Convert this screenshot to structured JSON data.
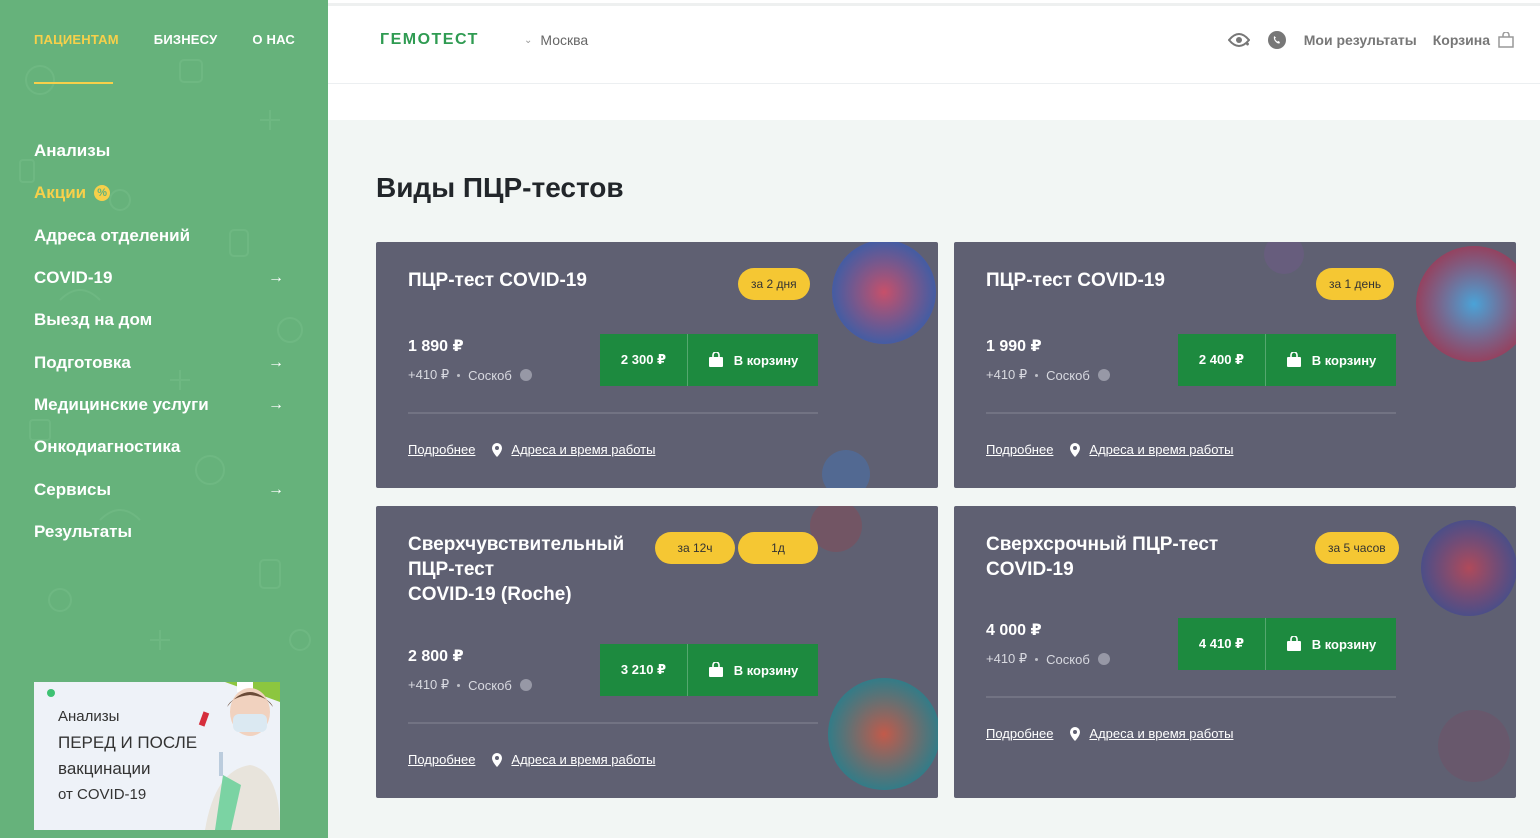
{
  "sidebar": {
    "topnav": [
      {
        "label": "ПАЦИЕНТАМ",
        "active": true
      },
      {
        "label": "БИЗНЕСУ",
        "active": false
      },
      {
        "label": "О НАС",
        "active": false
      }
    ],
    "menu": [
      {
        "label": "Анализы",
        "arrow": false
      },
      {
        "label": "Акции",
        "badge": "%",
        "promo": true,
        "arrow": false
      },
      {
        "label": "Адреса отделений",
        "arrow": false
      },
      {
        "label": "COVID-19",
        "arrow": true
      },
      {
        "label": "Выезд на дом",
        "arrow": false
      },
      {
        "label": "Подготовка",
        "arrow": true
      },
      {
        "label": "Медицинские услуги",
        "arrow": true
      },
      {
        "label": "Онкодиагностика",
        "arrow": false
      },
      {
        "label": "Сервисы",
        "arrow": true
      },
      {
        "label": "Результаты",
        "arrow": false
      }
    ],
    "arrow_glyph": "→",
    "promo_card": {
      "line1": "Анализы",
      "line2": "ПЕРЕД И ПОСЛЕ",
      "line3": "вакцинации",
      "line4": "от COVID-19"
    }
  },
  "header": {
    "logo": "ГЕМОТЕСТ",
    "city": "Москва",
    "results_label": "Мои результаты",
    "cart_label": "Корзина"
  },
  "main": {
    "title": "Виды ПЦР-тестов",
    "cards": [
      {
        "title_lines": [
          "ПЦР-тест COVID-19"
        ],
        "badges": [
          "за 2 дня"
        ],
        "price": "1 890 ₽",
        "extra": "+410 ₽",
        "method": "Соскоб",
        "button_price": "2 300 ₽",
        "button_label": "В корзину",
        "more_link": "Подробнее",
        "address_link": "Адреса и время работы"
      },
      {
        "title_lines": [
          "ПЦР-тест COVID-19"
        ],
        "badges": [
          "за 1 день"
        ],
        "price": "1 990 ₽",
        "extra": "+410 ₽",
        "method": "Соскоб",
        "button_price": "2 400 ₽",
        "button_label": "В корзину",
        "more_link": "Подробнее",
        "address_link": "Адреса и время работы"
      },
      {
        "title_lines": [
          "Сверхчувствительный",
          "ПЦР-тест",
          "COVID-19 (Roche)"
        ],
        "badges": [
          "за 12ч",
          "1д"
        ],
        "price": "2 800 ₽",
        "extra": "+410 ₽",
        "method": "Соскоб",
        "button_price": "3 210 ₽",
        "button_label": "В корзину",
        "more_link": "Подробнее",
        "address_link": "Адреса и время работы"
      },
      {
        "title_lines": [
          "Сверхсрочный ПЦР-тест",
          "COVID-19"
        ],
        "badges": [
          "за 5 часов"
        ],
        "price": "4 000 ₽",
        "extra": "+410 ₽",
        "method": "Соскоб",
        "button_price": "4 410 ₽",
        "button_label": "В корзину",
        "more_link": "Подробнее",
        "address_link": "Адреса и время работы"
      }
    ]
  },
  "colors": {
    "sidebar_green": "#66b27b",
    "accent_yellow": "#f7d04a",
    "brand_green": "#2f9b52",
    "buy_green": "#1d8a3f",
    "card_bg": "#5f6072",
    "badge_yellow": "#f5c733"
  }
}
